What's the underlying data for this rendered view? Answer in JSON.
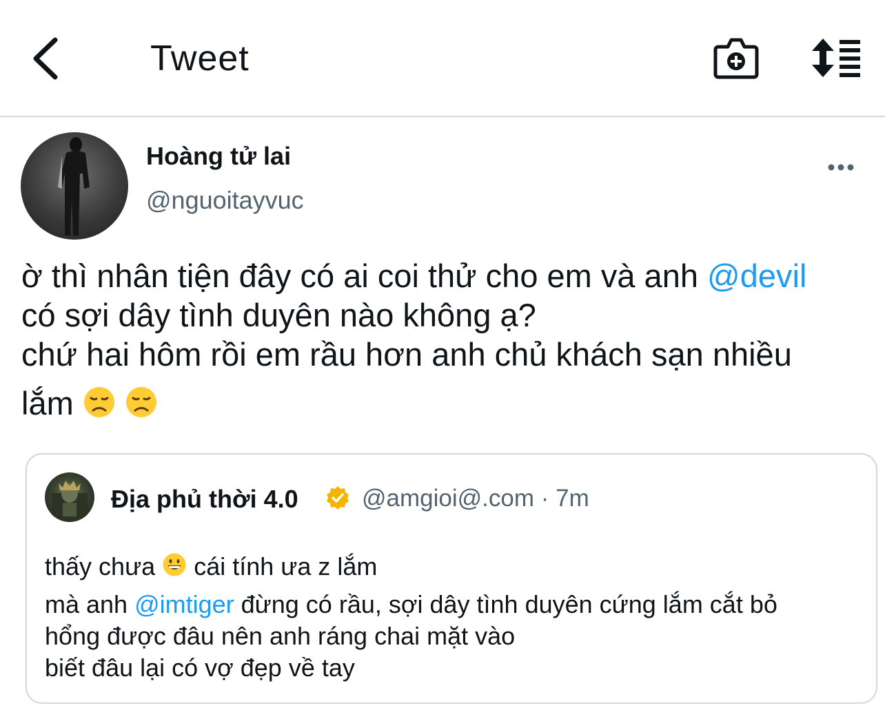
{
  "header": {
    "title": "Tweet",
    "back_icon": "chevron-left-icon",
    "camera_icon": "camera-plus-icon",
    "sort_icon": "sort-list-icon"
  },
  "tweet": {
    "author_name": "Hoàng tử lai",
    "author_handle": "@nguoitayvuc",
    "more_icon": "more-dots-icon",
    "text": {
      "line1_pre": "ờ thì nhân tiện đây có ai coi thử cho em và anh ",
      "mention": "@devil",
      "line2": "có sợi dây tình duyên nào không ạ?",
      "line3": "chứ hai hôm rồi em rầu hơn anh chủ khách sạn nhiều",
      "line4_pre": "lắm ",
      "emoji": "disappointed-face-emoji"
    }
  },
  "quote": {
    "author_name": "Địa phủ thời 4.0",
    "badge_icon": "verified-badge-icon",
    "badge_color": "#f4b400",
    "author_handle": "@amgioi@.com",
    "separator": " · ",
    "time": "7m",
    "text": {
      "line1_pre": "thấy chưa ",
      "line1_emoji": "grinning-face-emoji",
      "line1_post": " cái tính ưa z lắm",
      "line2_pre": "mà anh ",
      "line2_mention": "@imtiger",
      "line2_post": " đừng có rầu, sợi dây tình duyên cứng lắm cắt bỏ",
      "line3": "hổng được đâu nên anh ráng chai mặt vào",
      "line4": "biết đâu lại có vợ đẹp về tay"
    }
  },
  "colors": {
    "link": "#1d9bf0",
    "secondary_text": "#536471",
    "border": "#cfd9de"
  }
}
